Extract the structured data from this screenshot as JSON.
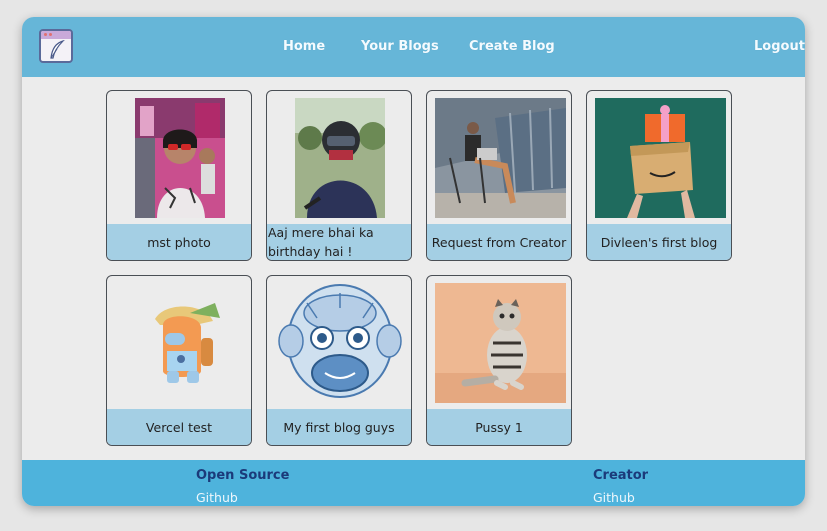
{
  "navbar": {
    "logo_icon": "feather-quill-icon",
    "links": [
      {
        "label": "Home"
      },
      {
        "label": "Your Blogs"
      },
      {
        "label": "Create Blog"
      }
    ],
    "logout_label": "Logout",
    "background_color": "#66b6d8"
  },
  "blogs": [
    {
      "title": "mst photo"
    },
    {
      "title": "Aaj mere bhai ka birthday hai !"
    },
    {
      "title": "Request from Creator"
    },
    {
      "title": "Divleen's first blog"
    },
    {
      "title": "Vercel test"
    },
    {
      "title": "My first blog guys"
    },
    {
      "title": "Pussy 1"
    }
  ],
  "footer": {
    "columns": [
      {
        "heading": "Open Source",
        "link": "Github"
      },
      {
        "heading": "Creator",
        "link": "Github"
      }
    ],
    "background_color": "#4eb3dc",
    "heading_color": "#1b3a7a"
  },
  "caption_color": "#a4cfe4"
}
